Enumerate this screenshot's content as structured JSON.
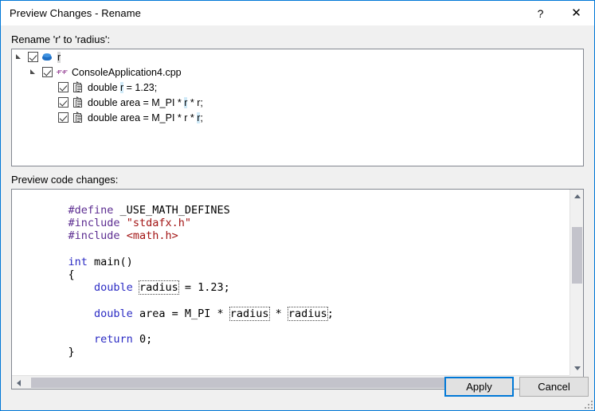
{
  "window": {
    "title": "Preview Changes - Rename",
    "help_glyph": "?",
    "close_glyph": "✕",
    "accent_color": "#0078d7",
    "titlebar_bg": "#ffffff",
    "dialog_bg": "#f0f0f0"
  },
  "labels": {
    "rename": "Rename 'r' to 'radius':",
    "preview": "Preview code changes:"
  },
  "tree": {
    "root": {
      "label": "r",
      "icon": "solution-icon",
      "checked": true,
      "expanded": true,
      "selected": true
    },
    "file": {
      "label": "ConsoleApplication4.cpp",
      "icon": "cpp-file-icon",
      "checked": true,
      "expanded": true
    },
    "occurrences": [
      {
        "icon": "code-line-icon",
        "checked": true,
        "prefix": "double ",
        "match": "r",
        "suffix": " = 1.23;"
      },
      {
        "icon": "code-line-icon",
        "checked": true,
        "prefix": "double area = M_PI * ",
        "match": "r",
        "suffix": " * r;"
      },
      {
        "icon": "code-line-icon",
        "checked": true,
        "prefix": "double area = M_PI * r * ",
        "match": "r",
        "suffix": ";"
      }
    ],
    "match_highlight_color": "#cfe9f7",
    "selection_color": "#d7d7d7"
  },
  "code": {
    "language": "cpp",
    "lines": [
      [
        {
          "t": "    ",
          "c": "plain"
        },
        {
          "t": "#define",
          "c": "pp"
        },
        {
          "t": " _USE_MATH_DEFINES",
          "c": "plain"
        }
      ],
      [
        {
          "t": "    ",
          "c": "plain"
        },
        {
          "t": "#include",
          "c": "pp"
        },
        {
          "t": " ",
          "c": "plain"
        },
        {
          "t": "\"stdafx.h\"",
          "c": "str"
        }
      ],
      [
        {
          "t": "    ",
          "c": "plain"
        },
        {
          "t": "#include",
          "c": "pp"
        },
        {
          "t": " ",
          "c": "plain"
        },
        {
          "t": "<math.h>",
          "c": "str"
        }
      ],
      [],
      [
        {
          "t": "    ",
          "c": "plain"
        },
        {
          "t": "int",
          "c": "kw"
        },
        {
          "t": " main()",
          "c": "plain"
        }
      ],
      [
        {
          "t": "    {",
          "c": "plain"
        }
      ],
      [
        {
          "t": "        ",
          "c": "plain"
        },
        {
          "t": "double",
          "c": "kw"
        },
        {
          "t": " ",
          "c": "plain"
        },
        {
          "t": "radius",
          "c": "plain",
          "box": true
        },
        {
          "t": " = 1.23;",
          "c": "plain"
        }
      ],
      [],
      [
        {
          "t": "        ",
          "c": "plain"
        },
        {
          "t": "double",
          "c": "kw"
        },
        {
          "t": " area = M_PI * ",
          "c": "plain"
        },
        {
          "t": "radius",
          "c": "plain",
          "box": true
        },
        {
          "t": " * ",
          "c": "plain"
        },
        {
          "t": "radius",
          "c": "plain",
          "box": true
        },
        {
          "t": ";",
          "c": "plain"
        }
      ],
      [],
      [
        {
          "t": "        ",
          "c": "plain"
        },
        {
          "t": "return",
          "c": "kw"
        },
        {
          "t": " 0;",
          "c": "plain"
        }
      ],
      [
        {
          "t": "    }",
          "c": "plain"
        }
      ]
    ],
    "colors": {
      "keyword": "#2b2bc4",
      "preprocessor": "#5c2d91",
      "string": "#a31515",
      "plain": "#000000"
    }
  },
  "scrollbars": {
    "vertical": {
      "up_arrow": "arrow-up-icon",
      "down_arrow": "arrow-down-icon",
      "thumb_top_pct": 15,
      "thumb_height_pct": 36
    },
    "horizontal": {
      "left_arrow": "arrow-left-icon",
      "right_arrow": "arrow-right-icon",
      "thumb_left_pct": 1,
      "thumb_width_pct": 87
    }
  },
  "footer": {
    "apply_label": "Apply",
    "cancel_label": "Cancel",
    "default_button": "Apply"
  }
}
